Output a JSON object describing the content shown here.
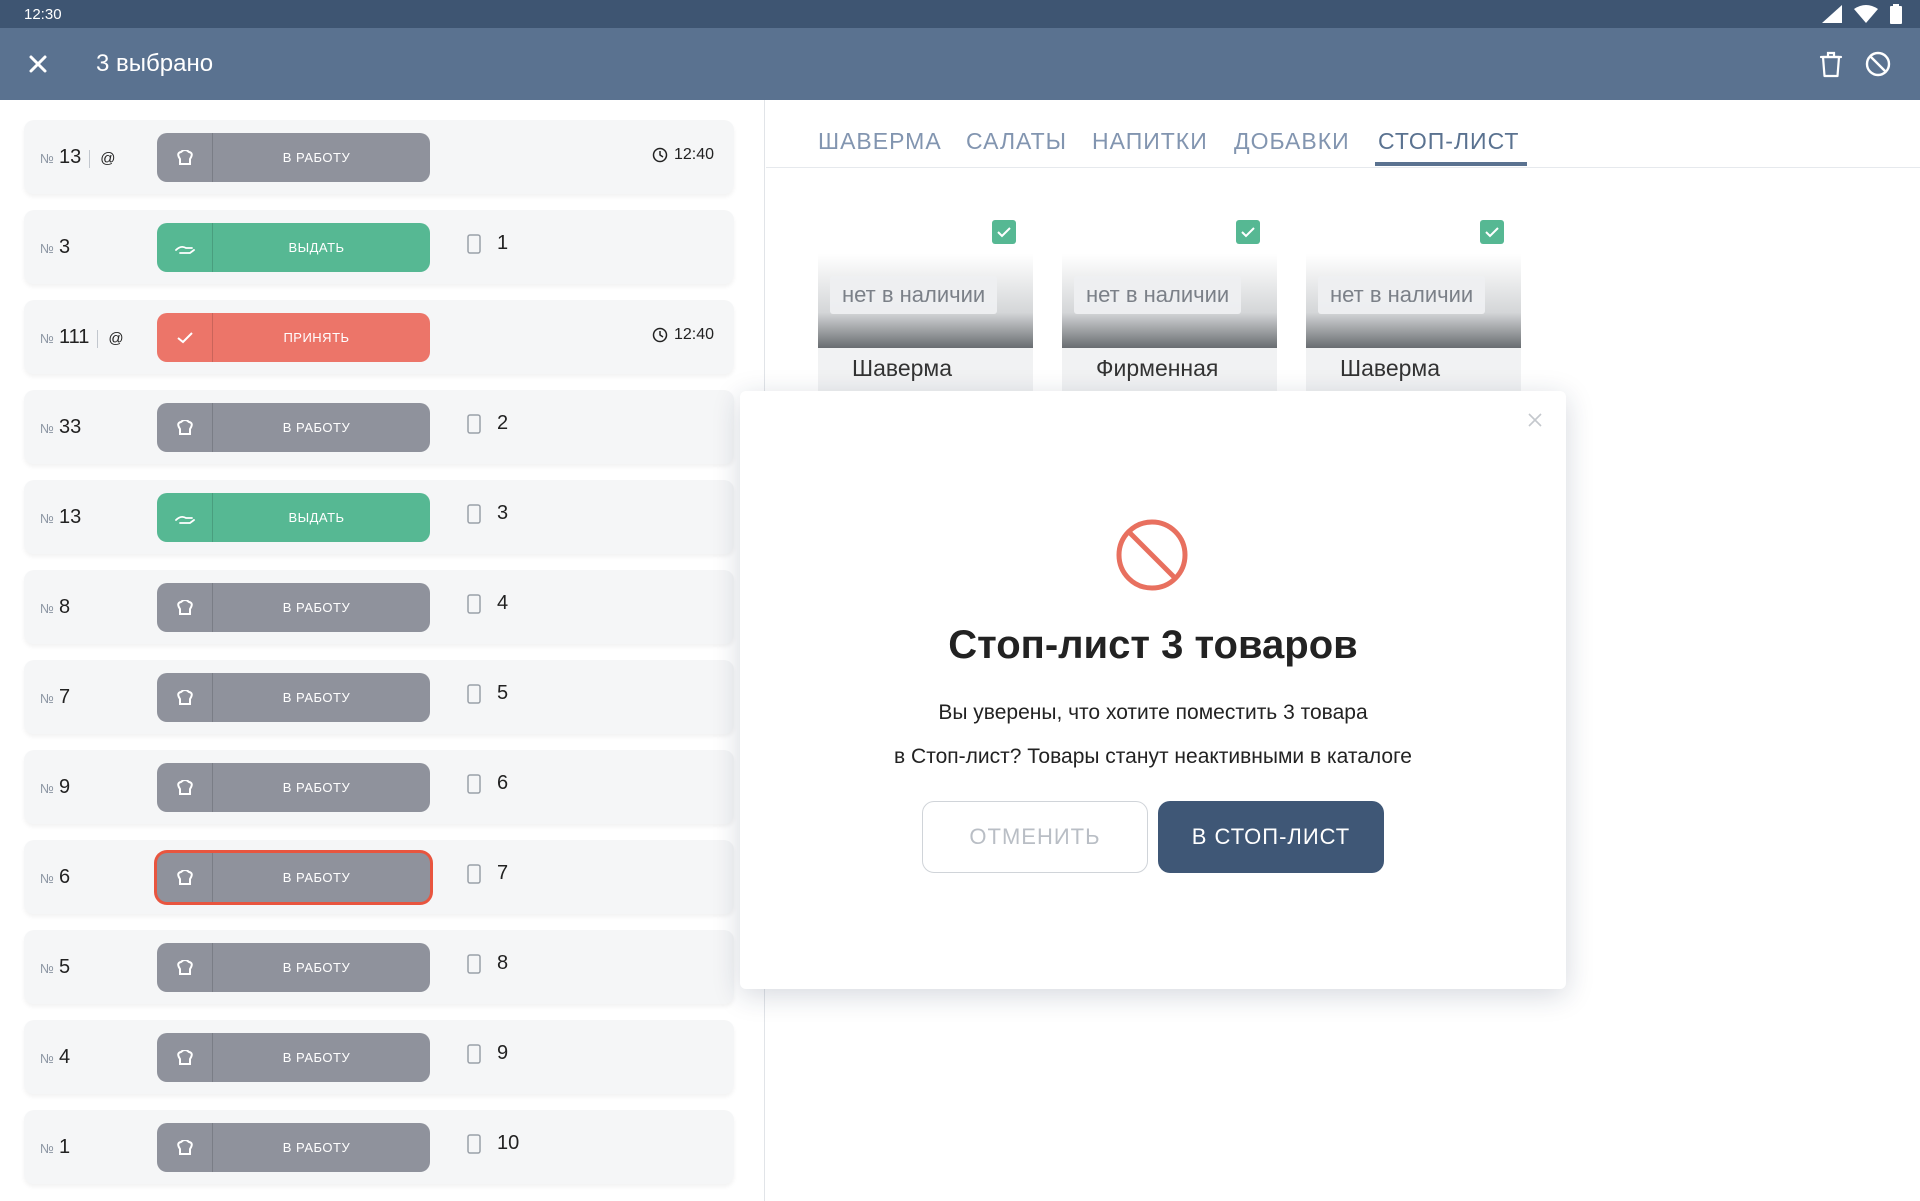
{
  "statusbar": {
    "time": "12:30",
    "icons": [
      "signal-icon",
      "wifi-icon",
      "battery-icon"
    ]
  },
  "appbar": {
    "title": "3 выбрано",
    "icons": [
      "close-icon",
      "trash-icon",
      "block-icon"
    ]
  },
  "colors": {
    "appbar": "#5a7290",
    "statusbar": "#3e5572",
    "gray_button": "#8f929c",
    "green_button": "#56b893",
    "red_button": "#ec7569",
    "danger_outline": "#e8553f",
    "confirm_button": "#3f5776",
    "danger_icon": "#e8705f"
  },
  "orders": [
    {
      "number_prefix": "№",
      "number": "13",
      "online": true,
      "button": "В РАБОТУ",
      "kind": "work",
      "time": "12:40"
    },
    {
      "number_prefix": "№",
      "number": "3",
      "online": false,
      "button": "ВЫДАТЬ",
      "kind": "give",
      "table": "1"
    },
    {
      "number_prefix": "№",
      "number": "111",
      "online": true,
      "button": "ПРИНЯТЬ",
      "kind": "accept",
      "time": "12:40"
    },
    {
      "number_prefix": "№",
      "number": "33",
      "online": false,
      "button": "В РАБОТУ",
      "kind": "work",
      "table": "2"
    },
    {
      "number_prefix": "№",
      "number": "13",
      "online": false,
      "button": "ВЫДАТЬ",
      "kind": "give",
      "table": "3"
    },
    {
      "number_prefix": "№",
      "number": "8",
      "online": false,
      "button": "В РАБОТУ",
      "kind": "work",
      "table": "4"
    },
    {
      "number_prefix": "№",
      "number": "7",
      "online": false,
      "button": "В РАБОТУ",
      "kind": "work",
      "table": "5"
    },
    {
      "number_prefix": "№",
      "number": "9",
      "online": false,
      "button": "В РАБОТУ",
      "kind": "work",
      "table": "6"
    },
    {
      "number_prefix": "№",
      "number": "6",
      "online": false,
      "button": "В РАБОТУ",
      "kind": "work",
      "table": "7",
      "highlighted": true
    },
    {
      "number_prefix": "№",
      "number": "5",
      "online": false,
      "button": "В РАБОТУ",
      "kind": "work",
      "table": "8"
    },
    {
      "number_prefix": "№",
      "number": "4",
      "online": false,
      "button": "В РАБОТУ",
      "kind": "work",
      "table": "9"
    },
    {
      "number_prefix": "№",
      "number": "1",
      "online": false,
      "button": "В РАБОТУ",
      "kind": "work",
      "table": "10"
    }
  ],
  "tabs": [
    {
      "label": "ШАВЕРМА",
      "active": false
    },
    {
      "label": "САЛАТЫ",
      "active": false
    },
    {
      "label": "НАПИТКИ",
      "active": false
    },
    {
      "label": "ДОБАВКИ",
      "active": false
    },
    {
      "label": "СТОП-ЛИСТ",
      "active": true
    }
  ],
  "products": [
    {
      "status": "нет в наличии",
      "name": "Шаверма",
      "checked": true
    },
    {
      "status": "нет в наличии",
      "name": "Фирменная",
      "checked": true
    },
    {
      "status": "нет в наличии",
      "name": "Шаверма",
      "checked": true
    }
  ],
  "dialog": {
    "title": "Стоп-лист 3 товаров",
    "text_line1": "Вы уверены, что хотите поместить 3 товара",
    "text_line2": "в Стоп-лист? Товары станут неактивными в каталоге",
    "cancel_label": "ОТМЕНИТЬ",
    "confirm_label": "В СТОП-ЛИСТ",
    "icon": "block-icon"
  }
}
